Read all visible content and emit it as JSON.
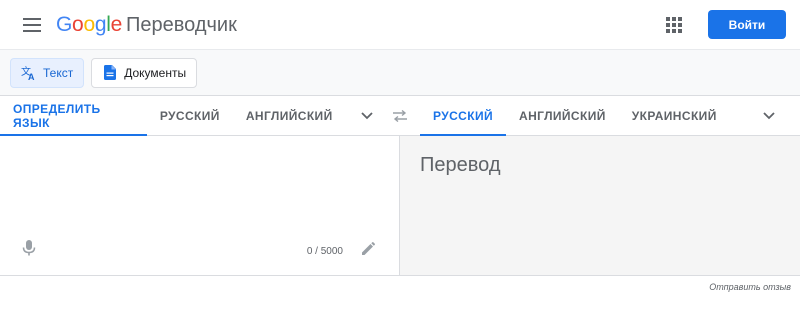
{
  "header": {
    "logo_google": "Google",
    "logo_product": "Переводчик",
    "login_label": "Войти"
  },
  "modes": [
    {
      "label": "Текст",
      "icon": "translate-icon"
    },
    {
      "label": "Документы",
      "icon": "document-icon"
    }
  ],
  "source_languages": [
    "ОПРЕДЕЛИТЬ ЯЗЫК",
    "РУССКИЙ",
    "АНГЛИЙСКИЙ"
  ],
  "target_languages": [
    "РУССКИЙ",
    "АНГЛИЙСКИЙ",
    "УКРАИНСКИЙ"
  ],
  "source": {
    "counter": "0 / 5000"
  },
  "target": {
    "placeholder": "Перевод"
  },
  "footer": {
    "feedback": "Отправить отзыв"
  },
  "colors": {
    "accent": "#1a73e8",
    "mode_active_bg": "#e8f0fe",
    "target_panel_bg": "#f5f5f5"
  }
}
